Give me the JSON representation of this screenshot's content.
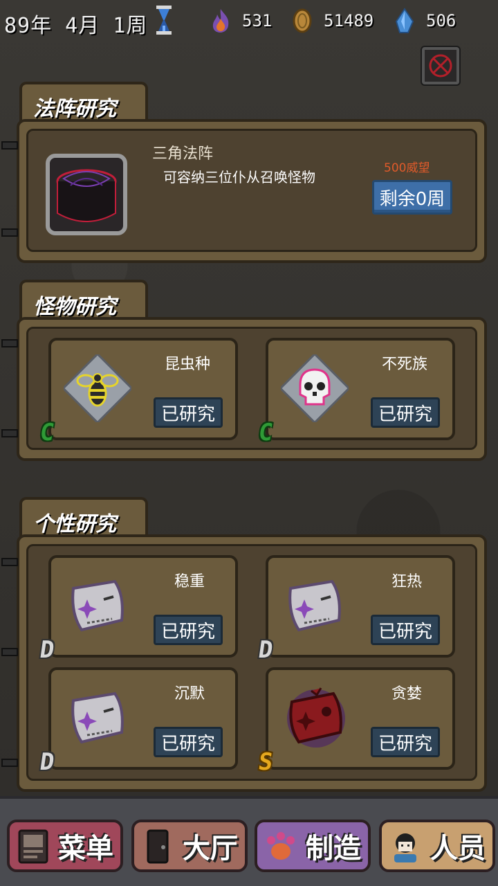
{
  "topbar": {
    "date": "89年 4月 1周",
    "fire": "531",
    "coins": "51489",
    "crystal": "506"
  },
  "sections": {
    "circle": {
      "tab": "法阵研究",
      "name": "三角法阵",
      "desc": "可容纳三位仆从召唤怪物",
      "cost": "500威望",
      "button": "剩余0周"
    },
    "monster": {
      "tab": "怪物研究",
      "cards": [
        {
          "name": "昆虫种",
          "button": "已研究",
          "grade": "C",
          "icon": "bee-icon"
        },
        {
          "name": "不死族",
          "button": "已研究",
          "grade": "C",
          "icon": "skull-icon"
        }
      ]
    },
    "personality": {
      "tab": "个性研究",
      "cards": [
        {
          "name": "稳重",
          "button": "已研究",
          "grade": "D",
          "icon": "mask-icon"
        },
        {
          "name": "狂热",
          "button": "已研究",
          "grade": "D",
          "icon": "mask-icon"
        },
        {
          "name": "沉默",
          "button": "已研究",
          "grade": "D",
          "icon": "mask-icon"
        },
        {
          "name": "贪婪",
          "button": "已研究",
          "grade": "S",
          "icon": "red-mask-icon"
        }
      ]
    }
  },
  "nav": {
    "menu": "菜单",
    "hall": "大厅",
    "craft": "制造",
    "staff": "人员"
  },
  "colors": {
    "panel": "#6b5b3d",
    "button_blue": "#3e6fa8",
    "cost_red": "#e05a2a"
  }
}
